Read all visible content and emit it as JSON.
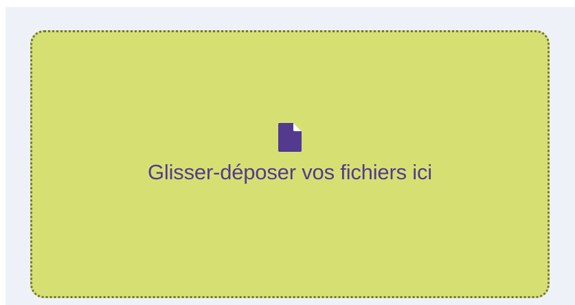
{
  "dropzone": {
    "label": "Glisser-déposer vos fichiers ici",
    "icon": "file-icon"
  },
  "colors": {
    "background": "#eef2f8",
    "dropzone_fill": "#d6e072",
    "dropzone_border": "#6f7440",
    "accent": "#533a8f"
  }
}
